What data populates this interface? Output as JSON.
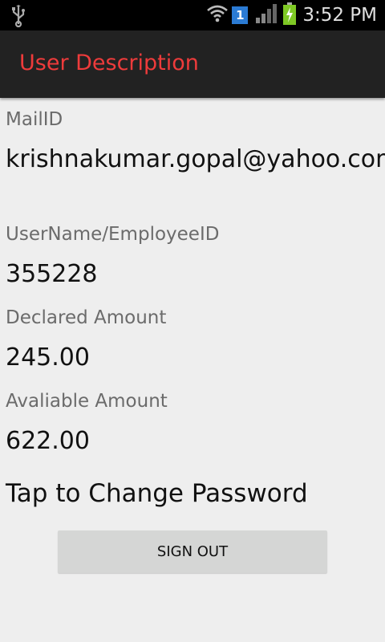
{
  "status_bar": {
    "time": "3:52 PM",
    "sim_badge": "1",
    "icons": [
      "usb-icon",
      "wifi-icon",
      "sim-icon",
      "signal-icon",
      "battery-charging-icon"
    ]
  },
  "action_bar": {
    "title": "User Description",
    "title_color": "#ee3b3b"
  },
  "details": {
    "mail_label": "MailID",
    "mail_value": "krishnakumar.gopal@yahoo.com",
    "username_label": "UserName/EmployeeID",
    "username_value": "355228",
    "declared_label": "Declared Amount",
    "declared_value": "245.00",
    "available_label": "Avaliable Amount",
    "available_value": "622.00",
    "change_password": "Tap to Change Password"
  },
  "sign_out_label": "SIGN OUT"
}
